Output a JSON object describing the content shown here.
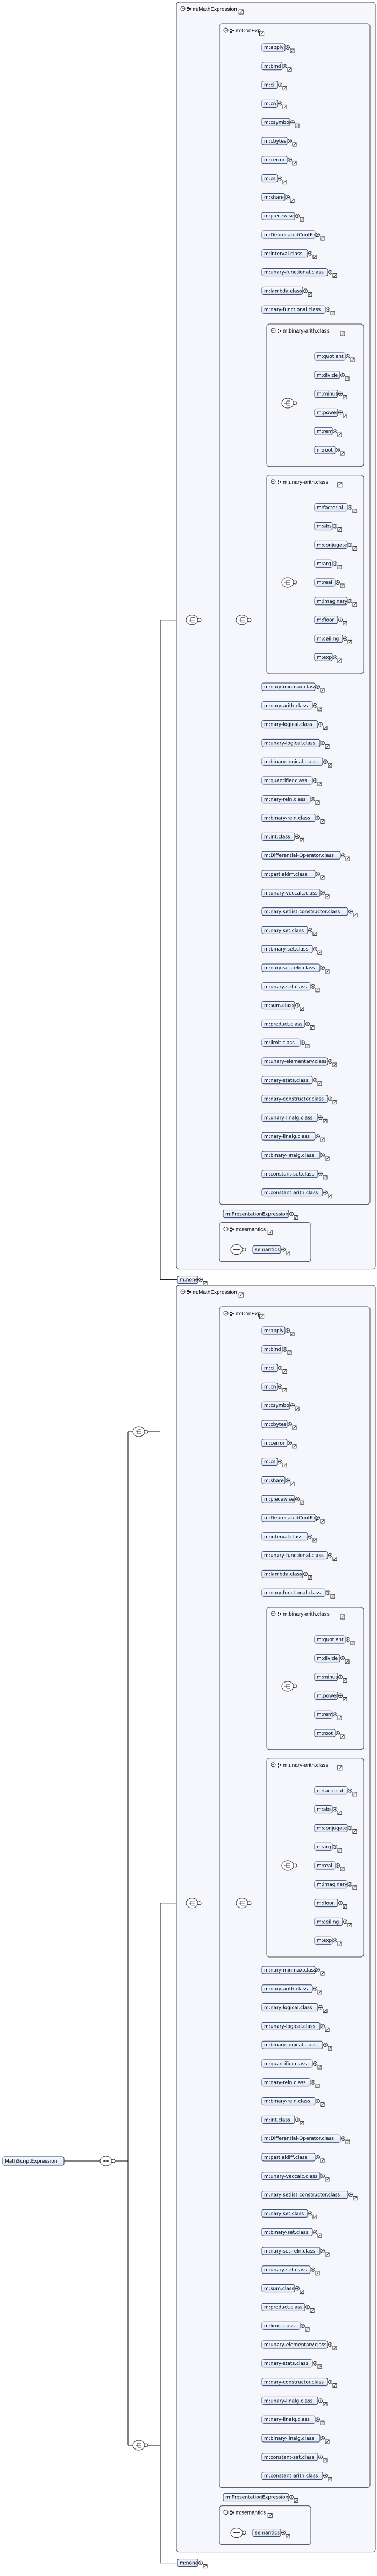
{
  "root": {
    "label": "MathScriptExpression"
  },
  "group_math": {
    "label": "m:MathExpression",
    "container": "m:ConExp",
    "semantics_group": "m:semantics",
    "semantics_item": "semantics",
    "presentation": "m:PresentationExpression",
    "none": "m:none"
  },
  "group_cnone": {
    "label": "m:MathExpression",
    "container": "m:ConExp",
    "semantics_group": "m:semantics",
    "semantics_item": "semantics",
    "presentation": "m:PresentationExpression",
    "none": "m:none"
  },
  "content_top": [
    "m:apply",
    "m:bind",
    "m:ci",
    "m:cn",
    "m:csymbol",
    "m:cbytes",
    "m:cerror",
    "m:cs",
    "m:share",
    "m:piecewise",
    "m:DeprecatedContExp",
    "m:interval.class",
    "m:unary-functional.class",
    "m:lambda.class",
    "m:nary-functional.class"
  ],
  "binary_arith": {
    "label": "m:binary-arith.class",
    "items": [
      "m:quotient",
      "m:divide",
      "m:minus",
      "m:power",
      "m:rem",
      "m:root"
    ]
  },
  "unary_arith": {
    "label": "m:unary-arith.class",
    "items": [
      "m:factorial",
      "m:abs",
      "m:conjugate",
      "m:arg",
      "m:real",
      "m:imaginary",
      "m:floor",
      "m:ceiling",
      "m:exp"
    ]
  },
  "content_bottom": [
    "m:nary-minmax.class",
    "m:nary-arith.class",
    "m:nary-logical.class",
    "m:unary-logical.class",
    "m:binary-logical.class",
    "m:quantifier.class",
    "m:nary-reln.class",
    "m:binary-reln.class",
    "m:int.class",
    "m:Differential-Operator.class",
    "m:partialdiff.class",
    "m:unary-veccalc.class",
    "m:nary-setlist-constructor.class",
    "m:nary-set.class",
    "m:binary-set.class",
    "m:nary-set-reln.class",
    "m:unary-set.class",
    "m:sum.class",
    "m:product.class",
    "m:limit.class",
    "m:unary-elementary.class",
    "m:nary-stats.class",
    "m:nary-constructor.class",
    "m:unary-linalg.class",
    "m:nary-linalg.class",
    "m:binary-linalg.class",
    "m:constant-set.class",
    "m:constant-arith.class"
  ]
}
